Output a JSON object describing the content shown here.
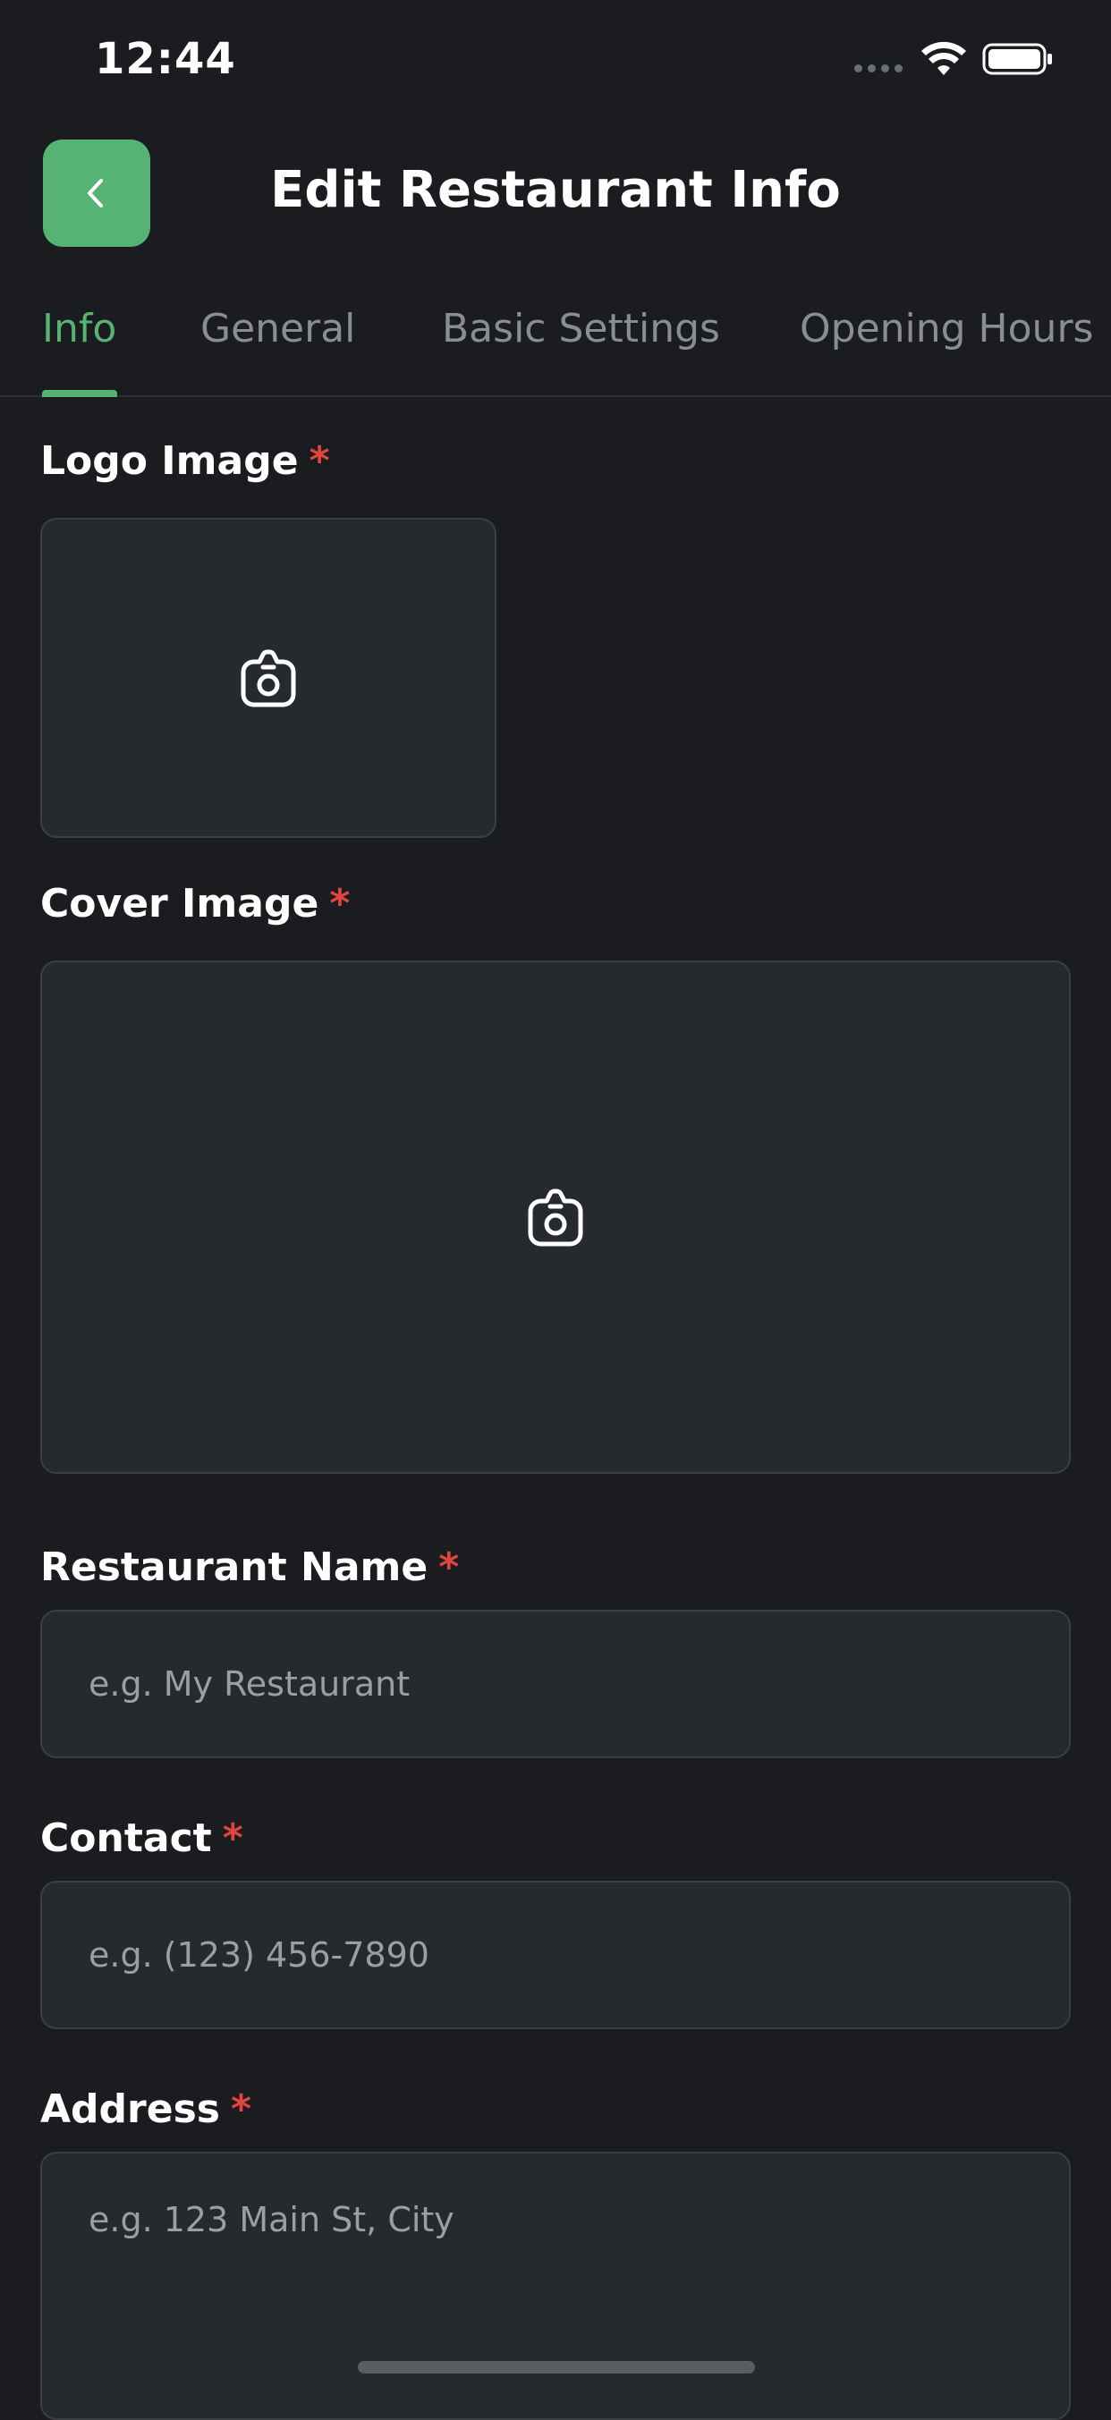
{
  "status_bar": {
    "time": "12:44"
  },
  "header": {
    "title": "Edit Restaurant Info",
    "back_icon": "chevron-left-icon",
    "accent_color": "#57b374"
  },
  "tabs": [
    {
      "label": "Info",
      "active": true
    },
    {
      "label": "General",
      "active": false
    },
    {
      "label": "Basic Settings",
      "active": false
    },
    {
      "label": "Opening Hours",
      "active": false
    }
  ],
  "form": {
    "required_marker": "*",
    "logo_image": {
      "label": "Logo Image",
      "icon": "camera-icon"
    },
    "cover_image": {
      "label": "Cover Image",
      "icon": "camera-icon"
    },
    "restaurant_name": {
      "label": "Restaurant Name",
      "placeholder": "e.g. My Restaurant",
      "value": ""
    },
    "contact": {
      "label": "Contact",
      "placeholder": "e.g. (123) 456-7890",
      "value": ""
    },
    "address": {
      "label": "Address",
      "placeholder": "e.g. 123 Main St, City",
      "value": ""
    }
  },
  "colors": {
    "background": "#1a1c1f",
    "surface": "#26292e",
    "required": "#e0463f",
    "inactive_tab": "#8a8d91"
  }
}
